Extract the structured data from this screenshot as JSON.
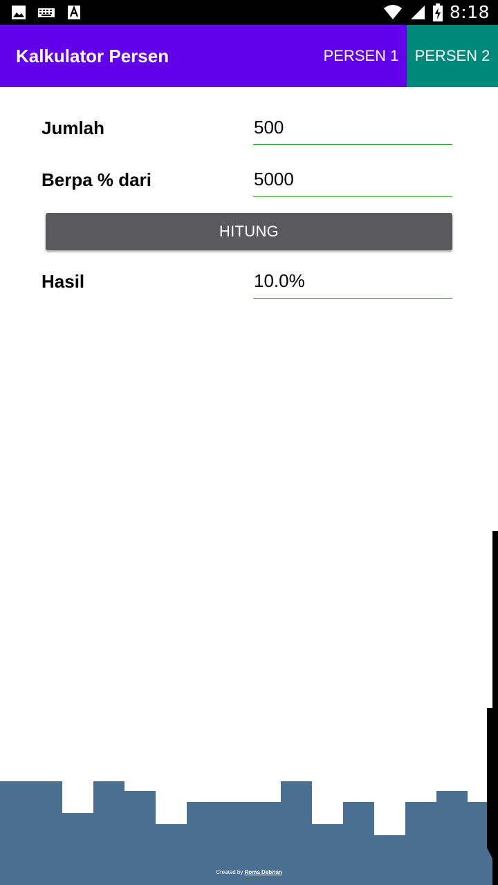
{
  "status_bar": {
    "time": "8:18",
    "icons": [
      "image-icon",
      "keyboard-icon",
      "text-a-icon",
      "wifi-icon",
      "signal-icon",
      "battery-charging-icon"
    ]
  },
  "app_bar": {
    "title": "Kalkulator Persen",
    "tabs": [
      {
        "label": "PERSEN 1",
        "selected": false
      },
      {
        "label": "PERSEN 2",
        "selected": true
      }
    ],
    "colors": {
      "primary": "#6200ea",
      "selected_tab": "#00897b"
    }
  },
  "form": {
    "jumlah": {
      "label": "Jumlah",
      "value": "500"
    },
    "berapa": {
      "label": "Berpa % dari",
      "value": "5000"
    },
    "hitung_button": "HITUNG",
    "hasil": {
      "label": "Hasil",
      "value": "10.0%"
    },
    "accent_color": "#4caf50"
  },
  "footer": {
    "credit_prefix": "Created by",
    "credit_author": "Roma Debrian",
    "skyline_color": "#4a6f91"
  }
}
